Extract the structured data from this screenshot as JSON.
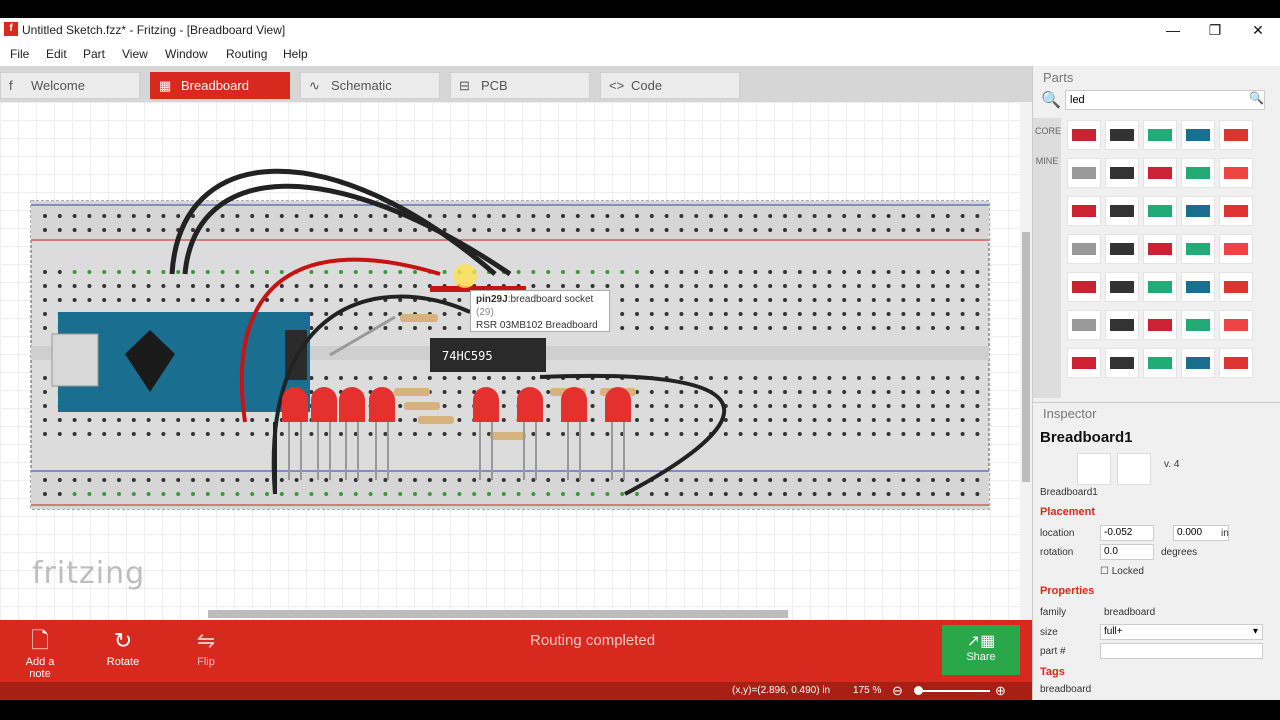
{
  "window": {
    "title": "Untitled Sketch.fzz* - Fritzing - [Breadboard View]",
    "app_icon": "f",
    "minimize": "—",
    "restore": "❐",
    "close": "✕"
  },
  "menu": [
    "File",
    "Edit",
    "Part",
    "View",
    "Window",
    "Routing",
    "Help"
  ],
  "tabs": [
    {
      "label": "Welcome",
      "icon": "f"
    },
    {
      "label": "Breadboard",
      "icon": "▦"
    },
    {
      "label": "Schematic",
      "icon": "∿"
    },
    {
      "label": "PCB",
      "icon": "⊟"
    },
    {
      "label": "Code",
      "icon": "<>"
    }
  ],
  "canvas": {
    "logo": "fritzing",
    "chip_label": "74HC595",
    "tooltip": {
      "name": "pin29J",
      "desc": ":breadboard socket",
      "number": "(29)",
      "part": "RSR 03MB102 Breadboard"
    }
  },
  "bottom": {
    "add_note": "Add a note",
    "rotate": "Rotate",
    "flip": "Flip",
    "routing_status": "Routing completed",
    "share": "Share"
  },
  "status": {
    "coords": "(x,y)=(2.896, 0.490) in",
    "zoom": "175 %",
    "zoom_out": "⊖",
    "zoom_in": "⊕"
  },
  "parts_panel": {
    "title": "Parts",
    "search_value": "led",
    "bins": [
      "CORE",
      "MINE"
    ]
  },
  "inspector": {
    "title": "Inspector",
    "part_name": "Breadboard1",
    "version": "v. 4",
    "caption": "Breadboard1",
    "placement_header": "Placement",
    "location_label": "location",
    "location_x": "-0.052",
    "location_y": "0.000",
    "location_unit": "in",
    "rotation_label": "rotation",
    "rotation_value": "0.0",
    "rotation_unit": "degrees",
    "locked_label": "Locked",
    "properties_header": "Properties",
    "family_label": "family",
    "family_value": "breadboard",
    "size_label": "size",
    "size_value": "full+",
    "part_label": "part #",
    "tags_header": "Tags",
    "tags_value": "breadboard"
  },
  "colors": {
    "accent": "#d7291e",
    "share_green": "#2aa748",
    "board_blue": "#1a6e8f"
  }
}
